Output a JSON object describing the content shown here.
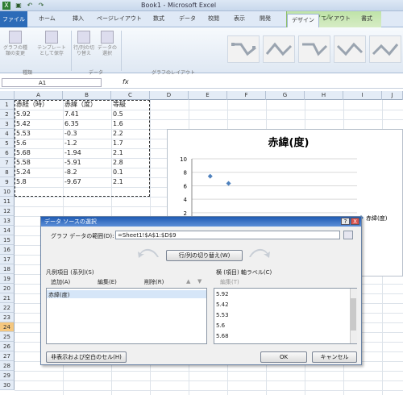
{
  "window": {
    "title": "Book1 - Microsoft Excel"
  },
  "ribbon": {
    "context_group": "グラフツール",
    "tabs": [
      "ファイル",
      "ホーム",
      "挿入",
      "ページレイアウト",
      "数式",
      "データ",
      "校閲",
      "表示",
      "開発",
      "デザイン",
      "レイアウト",
      "書式"
    ],
    "buttons": {
      "change_type": "グラフの種類の変更",
      "save_template": "テンプレートとして保存",
      "switch_row_col": "行/列の切り替え",
      "select_data": "データの選択"
    },
    "groups": {
      "type": "種類",
      "data": "データ",
      "layout": "グラフのレイアウト"
    }
  },
  "formula_bar": {
    "name_box": "A1",
    "fx": "fx",
    "formula": ""
  },
  "grid": {
    "columns": [
      "A",
      "B",
      "C",
      "D",
      "E",
      "F",
      "G",
      "H",
      "I",
      "J"
    ],
    "rows": [
      "1",
      "2",
      "3",
      "4",
      "5",
      "6",
      "7",
      "8",
      "9",
      "10",
      "11",
      "12",
      "13",
      "14",
      "15",
      "16",
      "17",
      "18",
      "19",
      "20",
      "21",
      "22",
      "23",
      "24",
      "25",
      "26",
      "27",
      "28",
      "29",
      "30"
    ],
    "selected_row": "24",
    "headers": [
      "赤経（時）",
      "赤緯（度）",
      "等級"
    ],
    "data": [
      [
        "5.92",
        "7.41",
        "0.5"
      ],
      [
        "5.42",
        "6.35",
        "1.6"
      ],
      [
        "5.53",
        "-0.3",
        "2.2"
      ],
      [
        "5.6",
        "-1.2",
        "1.7"
      ],
      [
        "5.68",
        "-1.94",
        "2.1"
      ],
      [
        "5.58",
        "-5.91",
        "2.8"
      ],
      [
        "5.24",
        "-8.2",
        "0.1"
      ],
      [
        "5.8",
        "-9.67",
        "2.1"
      ]
    ]
  },
  "chart": {
    "legend_label": "赤緯(度)",
    "y_ticks": [
      "10",
      "8",
      "6",
      "4",
      "2",
      "0"
    ]
  },
  "chart_data": {
    "type": "scatter",
    "title": "赤緯(度)",
    "series": [
      {
        "name": "赤緯(度)",
        "points": [
          [
            5.92,
            7.41
          ],
          [
            5.42,
            6.35
          ],
          [
            5.53,
            -0.3
          ],
          [
            5.6,
            -1.2
          ],
          [
            5.68,
            -1.94
          ],
          [
            5.58,
            -5.91
          ],
          [
            5.24,
            -8.2
          ],
          [
            5.8,
            -9.67
          ]
        ]
      }
    ],
    "ylim": [
      -12,
      10
    ],
    "legend": "right",
    "grid": true
  },
  "dialog": {
    "title": "データ ソースの選択",
    "help": "?",
    "close": "X",
    "range_label": "グラフ データの範囲(D):",
    "range_value": "=Sheet1!$A$1:$D$9",
    "switch_button": "行/列の切り替え(W)",
    "legend_header": "凡例項目 (系列)(S)",
    "add": "追加(A)",
    "edit": "編集(E)",
    "delete": "削除(R)",
    "series_items": [
      "赤緯(度)"
    ],
    "axis_header": "横 (項目) 軸ラベル(C)",
    "axis_edit": "編集(T)",
    "axis_items": [
      "5.92",
      "5.42",
      "5.53",
      "5.6",
      "5.68"
    ],
    "hidden_button": "非表示および空白のセル(H)",
    "ok": "OK",
    "cancel": "キャンセル"
  }
}
